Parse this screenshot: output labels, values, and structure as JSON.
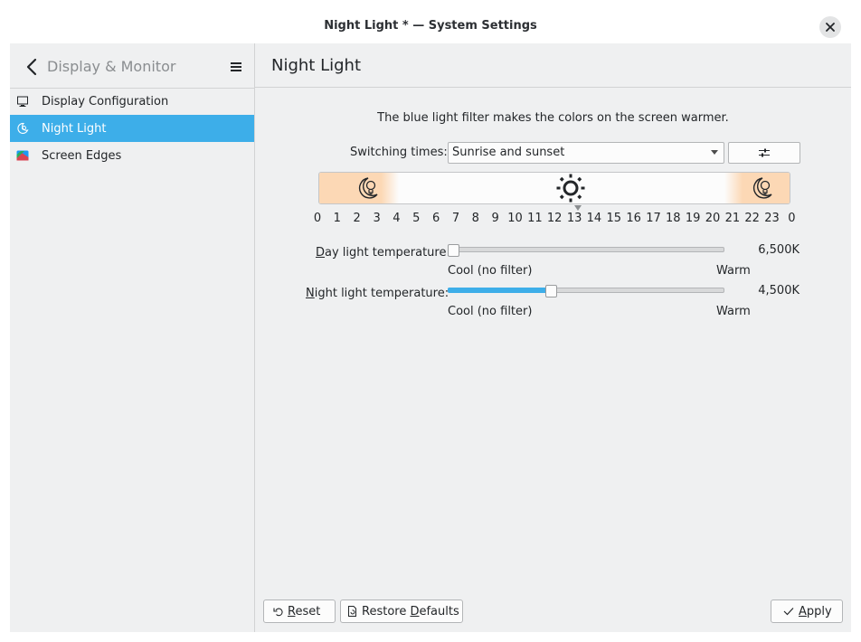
{
  "window": {
    "title": "Night Light * — System Settings"
  },
  "sidebar": {
    "heading": "Display & Monitor",
    "items": [
      {
        "label": "Display Configuration",
        "icon": "monitor-icon",
        "active": false
      },
      {
        "label": "Night Light",
        "icon": "night-light-icon",
        "active": true
      },
      {
        "label": "Screen Edges",
        "icon": "screen-edges-icon",
        "active": false
      }
    ]
  },
  "page": {
    "title": "Night Light",
    "intro": "The blue light filter makes the colors on the screen warmer.",
    "switching": {
      "label": "Switching times:",
      "value": "Sunrise and sunset"
    },
    "timeline": {
      "hours": [
        "0",
        "1",
        "2",
        "3",
        "4",
        "5",
        "6",
        "7",
        "8",
        "9",
        "10",
        "11",
        "12",
        "13",
        "14",
        "15",
        "16",
        "17",
        "18",
        "19",
        "20",
        "21",
        "22",
        "23",
        "0"
      ],
      "current_hour": 13
    },
    "day_temp": {
      "label_accel": "D",
      "label_rest": "ay light temperature:",
      "value": "6,500K",
      "level": 0.0,
      "min_label": "Cool (no filter)",
      "max_label": "Warm"
    },
    "night_temp": {
      "label_accel": "N",
      "label_rest": "ight light temperature:",
      "value": "4,500K",
      "level": 0.37,
      "min_label": "Cool (no filter)",
      "max_label": "Warm"
    }
  },
  "footer": {
    "reset": {
      "accel": "R",
      "rest": "eset"
    },
    "restore": {
      "before": "Restore ",
      "accel": "D",
      "rest": "efaults"
    },
    "apply": {
      "accel": "A",
      "rest": "pply"
    }
  },
  "colors": {
    "accent": "#3daee9",
    "night_band": "#fcd8b5",
    "window_bg": "#eff0f1"
  }
}
